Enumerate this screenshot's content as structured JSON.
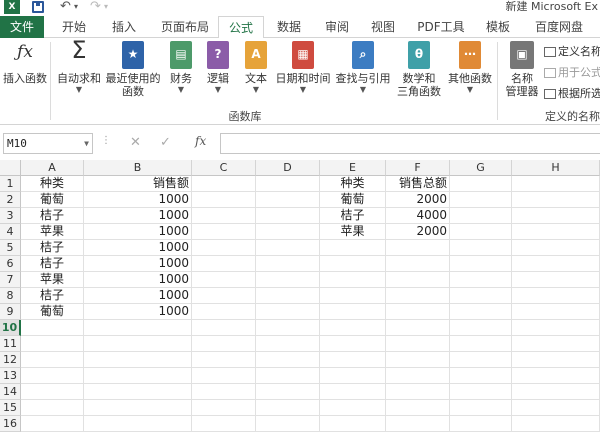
{
  "titlebar": {
    "app_icon_text": "X",
    "title": "新建 Microsoft Ex"
  },
  "tabs": [
    "文件",
    "开始",
    "插入",
    "页面布局",
    "公式",
    "数据",
    "审阅",
    "视图",
    "PDF工具",
    "模板",
    "百度网盘"
  ],
  "ribbon": {
    "insert_function": "插入函数",
    "autosum": "自动求和",
    "recent_line1": "最近使用的",
    "recent_line2": "函数",
    "financial": "财务",
    "logical": "逻辑",
    "text": "文本",
    "datetime": "日期和时间",
    "lookup": "查找与引用",
    "math_line1": "数学和",
    "math_line2": "三角函数",
    "more": "其他函数",
    "name_mgr_line1": "名称",
    "name_mgr_line2": "管理器",
    "define_name": "定义名称",
    "use_in_formula": "用于公式",
    "create_from_selection": "根据所选",
    "group_function_library": "函数库",
    "group_defined_names": "定义的名称"
  },
  "formula_bar": {
    "name_box": "M10",
    "fx": "fx",
    "formula": ""
  },
  "columns": [
    "A",
    "B",
    "C",
    "D",
    "E",
    "F",
    "G",
    "H"
  ],
  "rows": [
    "1",
    "2",
    "3",
    "4",
    "5",
    "6",
    "7",
    "8",
    "9",
    "10",
    "11",
    "12",
    "13",
    "14",
    "15",
    "16"
  ],
  "active_row": "10",
  "sheet": {
    "A": [
      "种类",
      "葡萄",
      "桔子",
      "苹果",
      "桔子",
      "桔子",
      "苹果",
      "桔子",
      "葡萄"
    ],
    "B": [
      "销售额",
      "1000",
      "1000",
      "1000",
      "1000",
      "1000",
      "1000",
      "1000",
      "1000"
    ],
    "E": [
      "种类",
      "葡萄",
      "桔子",
      "苹果"
    ],
    "F": [
      "销售总额",
      "2000",
      "4000",
      "2000"
    ]
  },
  "colors": {
    "excel_green": "#217346",
    "header_bg": "#f3f3f3",
    "grid_line": "#e1e1e1"
  }
}
